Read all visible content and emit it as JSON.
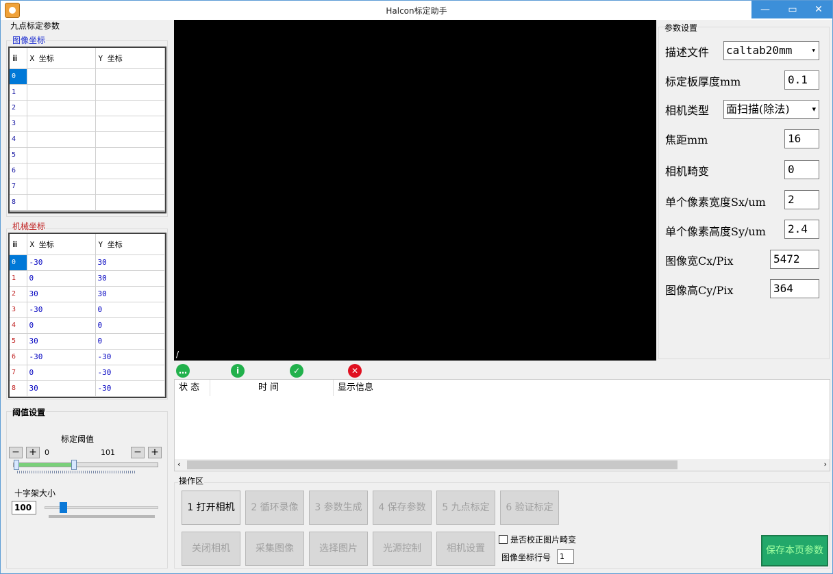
{
  "window": {
    "title": "Halcon标定助手",
    "min": "—",
    "max": "▭",
    "close": "✕"
  },
  "left": {
    "section_title": "九点标定参数",
    "image_coords": {
      "title": "图像坐标",
      "cols": [
        "X 坐标",
        "Y 坐标"
      ],
      "rows": [
        {
          "n": "0",
          "x": "",
          "y": ""
        },
        {
          "n": "1",
          "x": "",
          "y": ""
        },
        {
          "n": "2",
          "x": "",
          "y": ""
        },
        {
          "n": "3",
          "x": "",
          "y": ""
        },
        {
          "n": "4",
          "x": "",
          "y": ""
        },
        {
          "n": "5",
          "x": "",
          "y": ""
        },
        {
          "n": "6",
          "x": "",
          "y": ""
        },
        {
          "n": "7",
          "x": "",
          "y": ""
        },
        {
          "n": "8",
          "x": "",
          "y": ""
        }
      ]
    },
    "mech_coords": {
      "title": "机械坐标",
      "cols": [
        "X 坐标",
        "Y 坐标"
      ],
      "rows": [
        {
          "n": "0",
          "x": "-30",
          "y": "30"
        },
        {
          "n": "1",
          "x": "0",
          "y": "30"
        },
        {
          "n": "2",
          "x": "30",
          "y": "30"
        },
        {
          "n": "3",
          "x": "-30",
          "y": "0"
        },
        {
          "n": "4",
          "x": "0",
          "y": "0"
        },
        {
          "n": "5",
          "x": "30",
          "y": "0"
        },
        {
          "n": "6",
          "x": "-30",
          "y": "-30"
        },
        {
          "n": "7",
          "x": "0",
          "y": "-30"
        },
        {
          "n": "8",
          "x": "30",
          "y": "-30"
        }
      ]
    },
    "threshold": {
      "title": "阈值设置",
      "label": "标定阈值",
      "min": "0",
      "max": "101",
      "low_fraction": 0.0,
      "high_fraction": 0.42,
      "minus": "−",
      "plus": "+"
    },
    "crosshair": {
      "label": "十字架大小",
      "value": "100",
      "fraction": 0.13
    }
  },
  "canvas": {
    "label": "/"
  },
  "status_tabs": [
    {
      "label": "提示",
      "icon": "chat-icon",
      "color": "#22b14c"
    },
    {
      "label": "信息",
      "icon": "info-icon",
      "color": "#22b14c"
    },
    {
      "label": "完成",
      "icon": "check-icon",
      "color": "#22b14c"
    },
    {
      "label": "错误",
      "icon": "error-icon",
      "color": "#e01020"
    }
  ],
  "log": {
    "cols": [
      "状 态",
      "时 间",
      "显示信息"
    ]
  },
  "params": {
    "title": "参数设置",
    "desc_file": {
      "label": "描述文件",
      "value": "caltab20mm"
    },
    "thickness": {
      "label": "标定板厚度mm",
      "value": "0.1"
    },
    "cam_type": {
      "label": "相机类型",
      "value": "面扫描(除法)"
    },
    "focal": {
      "label": "焦距mm",
      "value": "16"
    },
    "distortion": {
      "label": "相机畸变",
      "value": "0"
    },
    "sx": {
      "label": "单个像素宽度Sx/um",
      "value": "2"
    },
    "sy": {
      "label": "单个像素高度Sy/um",
      "value": "2.4"
    },
    "cx": {
      "label": "图像宽Cx/Pix",
      "value": "5472"
    },
    "cy": {
      "label": "图像高Cy/Pix",
      "value": "364"
    }
  },
  "ops": {
    "title": "操作区",
    "row1": [
      "1 打开相机",
      "2 循环录像",
      "3 参数生成",
      "4 保存参数",
      "5 九点标定",
      "6 验证标定"
    ],
    "row2": [
      "关闭相机",
      "采集图像",
      "选择图片",
      "光源控制",
      "相机设置"
    ],
    "correct_label": "是否校正图片畸变",
    "row_no_label": "图像坐标行号",
    "row_no_value": "1",
    "save_label": "保存本页参数"
  }
}
